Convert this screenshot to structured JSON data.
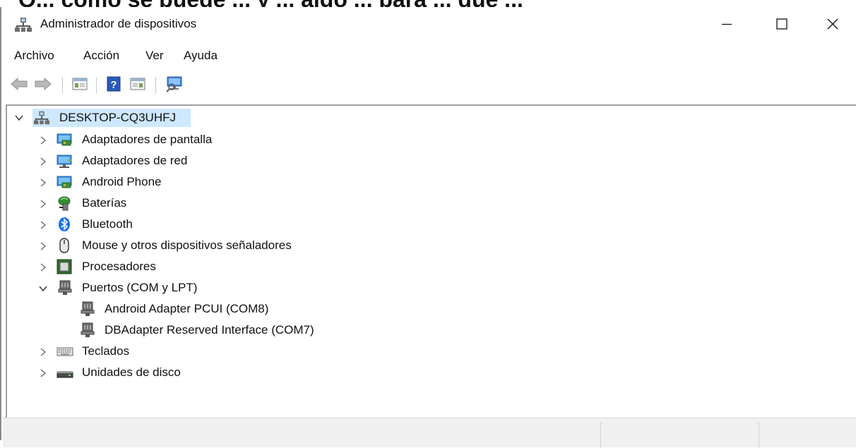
{
  "overlay_text": "Q... cómo se puede ... y ... algo ... para ... que ...",
  "window": {
    "title": "Administrador de dispositivos",
    "controls": {
      "minimize": "minimize-icon",
      "maximize": "maximize-icon",
      "close": "close-icon"
    }
  },
  "menu": {
    "items": [
      "Archivo",
      "Acción",
      "Ver",
      "Ayuda"
    ]
  },
  "toolbar": {
    "buttons": [
      "back-arrow-icon",
      "forward-arrow-icon",
      "properties-icon",
      "help-icon",
      "update-driver-icon",
      "scan-hardware-icon"
    ]
  },
  "tree": {
    "root": {
      "label": "DESKTOP-CQ3UHFJ",
      "expanded": true,
      "selected": true
    },
    "categories": [
      {
        "label": "Adaptadores de pantalla",
        "icon": "display-adapter-icon",
        "expanded": false
      },
      {
        "label": "Adaptadores de red",
        "icon": "network-adapter-icon",
        "expanded": false
      },
      {
        "label": "Android Phone",
        "icon": "android-phone-icon",
        "expanded": false
      },
      {
        "label": "Baterías",
        "icon": "battery-icon",
        "expanded": false
      },
      {
        "label": "Bluetooth",
        "icon": "bluetooth-icon",
        "expanded": false
      },
      {
        "label": "Mouse y otros dispositivos señaladores",
        "icon": "mouse-icon",
        "expanded": false
      },
      {
        "label": "Procesadores",
        "icon": "processor-icon",
        "expanded": false
      },
      {
        "label": "Puertos (COM y LPT)",
        "icon": "port-icon",
        "expanded": true,
        "children": [
          {
            "label": "Android Adapter PCUI (COM8)",
            "icon": "port-icon"
          },
          {
            "label": "DBAdapter Reserved Interface (COM7)",
            "icon": "port-icon"
          }
        ]
      },
      {
        "label": "Teclados",
        "icon": "keyboard-icon",
        "expanded": false
      },
      {
        "label": "Unidades de disco",
        "icon": "disk-drive-icon",
        "expanded": false
      }
    ]
  },
  "colors": {
    "selection": "#cde8ff",
    "statusbar": "#f0f0f0"
  }
}
